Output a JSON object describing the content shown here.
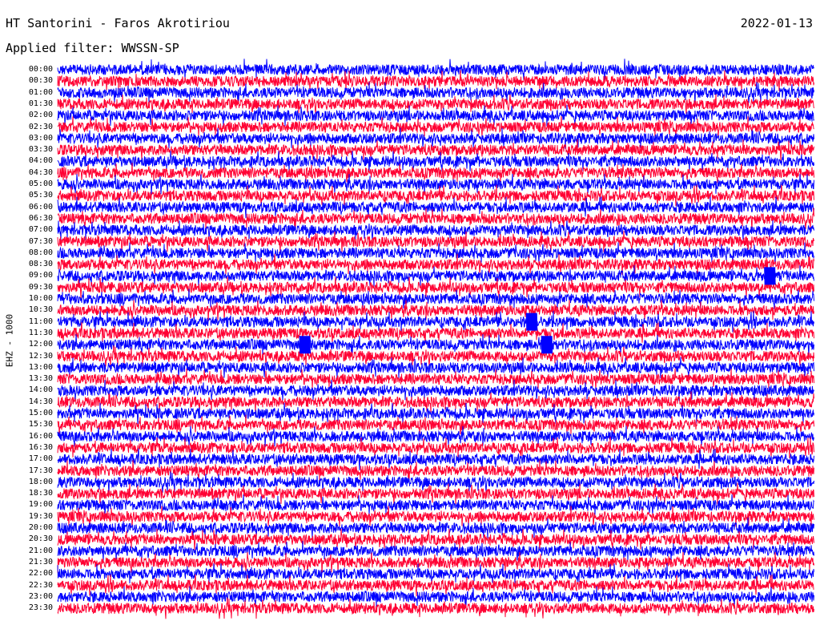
{
  "header": {
    "station": "HT Santorini - Faros Akrotiriou",
    "date": "2022-01-13",
    "filter": "Applied filter: WWSSN-SP"
  },
  "chart_data": {
    "type": "line",
    "title": "HT Santorini - Faros Akrotiriou",
    "subtitle": "Applied filter: WWSSN-SP",
    "ylabel": "EHZ - 1000",
    "xlabel": "",
    "colors": [
      "#0000ff",
      "#ff0033"
    ],
    "row_labels": [
      "00:00",
      "00:30",
      "01:00",
      "01:30",
      "02:00",
      "02:30",
      "03:00",
      "03:30",
      "04:00",
      "04:30",
      "05:00",
      "05:30",
      "06:00",
      "06:30",
      "07:00",
      "07:30",
      "08:00",
      "08:30",
      "09:00",
      "09:30",
      "10:00",
      "10:30",
      "11:00",
      "11:30",
      "12:00",
      "12:30",
      "13:00",
      "13:30",
      "14:00",
      "14:30",
      "15:00",
      "15:30",
      "16:00",
      "16:30",
      "17:00",
      "17:30",
      "18:00",
      "18:30",
      "19:00",
      "19:30",
      "20:00",
      "20:30",
      "21:00",
      "21:30",
      "22:00",
      "22:30",
      "23:00",
      "23:30"
    ],
    "events": [
      {
        "row": "09:00",
        "x_fraction": 0.935
      },
      {
        "row": "11:00",
        "x_fraction": 0.62
      },
      {
        "row": "12:00",
        "x_fraction": 0.32
      },
      {
        "row": "12:00",
        "x_fraction": 0.64
      }
    ]
  }
}
